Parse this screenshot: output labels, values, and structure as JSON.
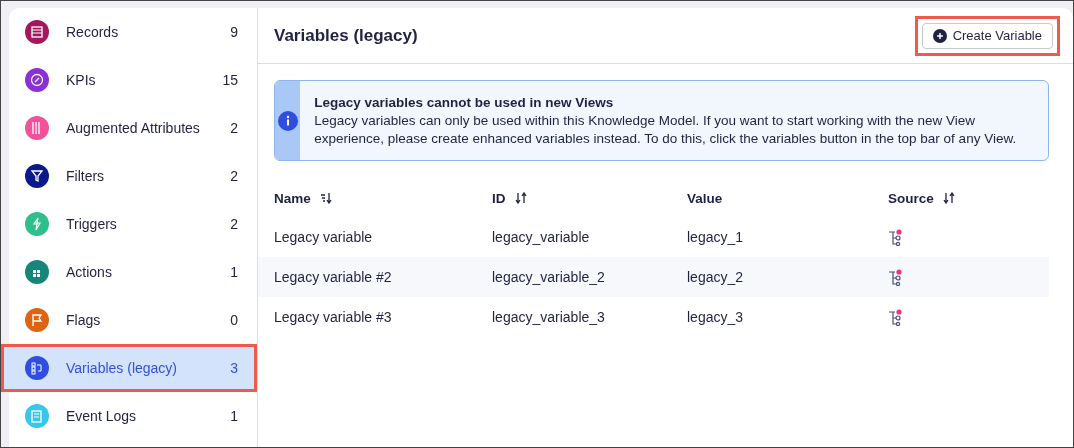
{
  "sidebar": {
    "items": [
      {
        "label": "Records",
        "count": "9",
        "color": "#a3175f",
        "selected": false
      },
      {
        "label": "KPIs",
        "count": "15",
        "color": "#8e2fd6",
        "selected": false
      },
      {
        "label": "Augmented Attributes",
        "count": "2",
        "color": "#f0529c",
        "selected": false
      },
      {
        "label": "Filters",
        "count": "2",
        "color": "#0a1a8c",
        "selected": false
      },
      {
        "label": "Triggers",
        "count": "2",
        "color": "#2fbf8a",
        "selected": false
      },
      {
        "label": "Actions",
        "count": "1",
        "color": "#16867a",
        "selected": false
      },
      {
        "label": "Flags",
        "count": "0",
        "color": "#dd6512",
        "selected": false
      },
      {
        "label": "Variables (legacy)",
        "count": "3",
        "color": "#2f4ee0",
        "selected": true
      },
      {
        "label": "Event Logs",
        "count": "1",
        "color": "#37c6ee",
        "selected": false
      }
    ]
  },
  "header": {
    "title": "Variables (legacy)",
    "button": {
      "label": "Create Variable",
      "highlighted": true
    }
  },
  "notice": {
    "title": "Legacy variables cannot be used in new Views",
    "text": "Legacy variables can only be used within this Knowledge Model. If you want to start working with the new View experience, please create enhanced variables instead. To do this, click the variables button in the top bar of any View."
  },
  "table": {
    "columns": [
      {
        "label": "Name",
        "kind": "sorted"
      },
      {
        "label": "ID",
        "kind": "sortable"
      },
      {
        "label": "Value",
        "kind": "plain"
      },
      {
        "label": "Source",
        "kind": "sortable"
      }
    ],
    "rows": [
      {
        "name": "Legacy variable",
        "id": "legacy_variable",
        "value": "legacy_1"
      },
      {
        "name": "Legacy variable #2",
        "id": "legacy_variable_2",
        "value": "legacy_2"
      },
      {
        "name": "Legacy variable #3",
        "id": "legacy_variable_3",
        "value": "legacy_3"
      }
    ]
  }
}
